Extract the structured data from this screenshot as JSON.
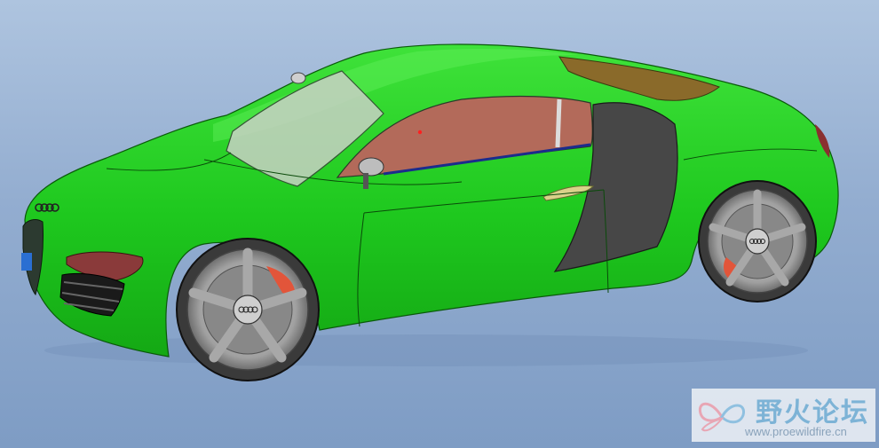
{
  "viewport": {
    "background_top": "#aec4df",
    "background_bottom": "#7e9cc4"
  },
  "model": {
    "body_color": "#1ec81e",
    "window_color": "#b36a5a",
    "glass_color": "#c8d0c4",
    "side_intake_color": "#474747",
    "wheel_color": "#8c8c8c"
  },
  "watermark": {
    "title": "野火论坛",
    "url": "www.proewildfire.cn",
    "color": "#7db3d6"
  }
}
